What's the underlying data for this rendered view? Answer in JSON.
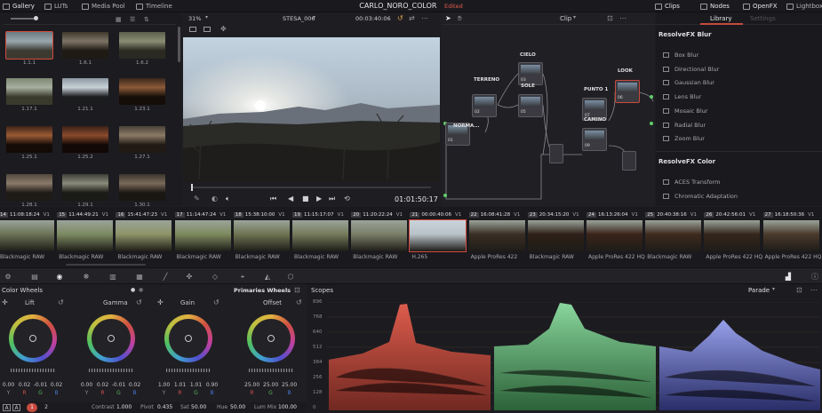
{
  "topbar": {
    "gallery": "Gallery",
    "luts": "LUTs",
    "media_pool": "Media Pool",
    "timeline": "Timeline",
    "project_title": "CARLO_NORO_COLOR",
    "edited": "Edited",
    "clips": "Clips",
    "nodes": "Nodes",
    "openfx": "OpenFX",
    "lightbox": "Lightbox"
  },
  "gallery": {
    "stills": [
      {
        "label": "1.1.1"
      },
      {
        "label": "1.6.1"
      },
      {
        "label": "1.6.2"
      },
      {
        "label": "1.17.1"
      },
      {
        "label": "1.21.1"
      },
      {
        "label": "1.23.1"
      },
      {
        "label": "1.25.1"
      },
      {
        "label": "1.25.2"
      },
      {
        "label": "1.27.1"
      },
      {
        "label": "1.28.1"
      },
      {
        "label": "1.29.1"
      },
      {
        "label": "1.30.1"
      }
    ]
  },
  "viewer": {
    "zoom": "31%",
    "clip_name": "STESA_006",
    "timecode_top": "00:03:40:06",
    "timecode": "01:01:50:17",
    "mode": "Clip"
  },
  "nodes": {
    "labels": [
      "CIELO",
      "TERRENO",
      "SOLE",
      "NORMA...",
      "PUNTO 1",
      "CAMINO",
      "LOOK"
    ],
    "numbers": [
      "03",
      "02",
      "05",
      "01",
      "07",
      "09",
      "06"
    ]
  },
  "library": {
    "tab_library": "Library",
    "tab_settings": "Settings",
    "section_blur": "ResolveFX Blur",
    "blur_items": [
      "Box Blur",
      "Directional Blur",
      "Gaussian Blur",
      "Lens Blur",
      "Mosaic Blur",
      "Radial Blur",
      "Zoom Blur"
    ],
    "section_color": "ResolveFX Color",
    "color_items": [
      "ACES Transform",
      "Chromatic Adaptation"
    ]
  },
  "clips": [
    {
      "num": "14",
      "tc": "11:08:18:24",
      "track": "V1",
      "codec": "Blackmagic RAW"
    },
    {
      "num": "15",
      "tc": "11:44:49:21",
      "track": "V1",
      "codec": "Blackmagic RAW"
    },
    {
      "num": "16",
      "tc": "15:41:47:23",
      "track": "V1",
      "codec": "Blackmagic RAW"
    },
    {
      "num": "17",
      "tc": "11:14:47:24",
      "track": "V1",
      "codec": "Blackmagic RAW"
    },
    {
      "num": "18",
      "tc": "15:38:10:00",
      "track": "V1",
      "codec": "Blackmagic RAW"
    },
    {
      "num": "19",
      "tc": "11:15:17:07",
      "track": "V1",
      "codec": "Blackmagic RAW"
    },
    {
      "num": "20",
      "tc": "11:20:22:24",
      "track": "V1",
      "codec": "Blackmagic RAW"
    },
    {
      "num": "21",
      "tc": "00:00:40:06",
      "track": "V1",
      "codec": "H.265"
    },
    {
      "num": "22",
      "tc": "16:08:41:28",
      "track": "V1",
      "codec": "Apple ProRes 422"
    },
    {
      "num": "23",
      "tc": "20:34:15:20",
      "track": "V1",
      "codec": "Blackmagic RAW"
    },
    {
      "num": "24",
      "tc": "16:13:26:04",
      "track": "V1",
      "codec": "Apple ProRes 422 HQ"
    },
    {
      "num": "25",
      "tc": "20:40:38:16",
      "track": "V1",
      "codec": "Blackmagic RAW"
    },
    {
      "num": "26",
      "tc": "20:42:56:01",
      "track": "V1",
      "codec": "Apple ProRes 422 HQ"
    },
    {
      "num": "27",
      "tc": "16:18:50:36",
      "track": "V1",
      "codec": "Apple ProRes 422 HQ"
    }
  ],
  "wheels": {
    "panel_title": "Color Wheels",
    "mode": "Primaries Wheels",
    "channel_labels": [
      "Y",
      "R",
      "G",
      "B"
    ],
    "lift": {
      "label": "Lift",
      "values": [
        "0.00",
        "0.02",
        "-0.01",
        "0.02"
      ]
    },
    "gamma": {
      "label": "Gamma",
      "values": [
        "0.00",
        "0.02",
        "-0.01",
        "0.02"
      ]
    },
    "gain": {
      "label": "Gain",
      "values": [
        "1.00",
        "1.01",
        "1.01",
        "0.90"
      ]
    },
    "offset": {
      "label": "Offset",
      "values": [
        "25.00",
        "25.00",
        "25.00"
      ]
    },
    "footer": {
      "contrast_label": "Contrast",
      "contrast": "1.000",
      "pivot_label": "Pivot",
      "pivot": "0.435",
      "sat_label": "Sat",
      "sat": "50.00",
      "hue_label": "Hue",
      "hue": "50.00",
      "lummix_label": "Lum Mix",
      "lummix": "100.00",
      "page1": "1",
      "page2": "2"
    }
  },
  "scopes": {
    "title": "Scopes",
    "mode": "Parade",
    "scale": [
      "896",
      "768",
      "640",
      "512",
      "384",
      "256",
      "128",
      "0"
    ]
  },
  "colors": {
    "accent_red": "#e25c4f",
    "selection_blue": "#4a77d6",
    "parade_red": "#e8604f",
    "parade_green": "#5fd07a",
    "parade_blue": "#6a7cf0"
  }
}
